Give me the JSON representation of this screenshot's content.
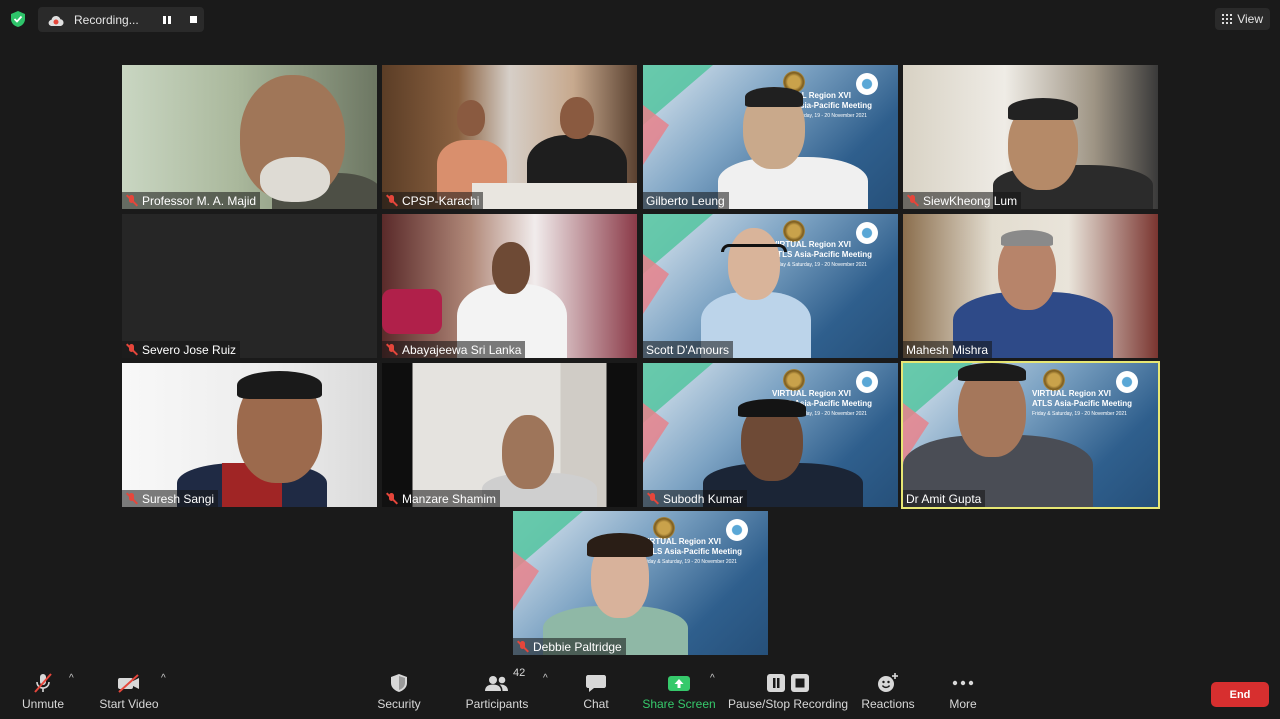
{
  "top_bar": {
    "recording_label": "Recording...",
    "view_label": "View"
  },
  "participants": [
    {
      "name": "Professor M. A. Majid",
      "muted": true
    },
    {
      "name": "CPSP-Karachi",
      "muted": true
    },
    {
      "name": "Gilberto Leung",
      "muted": false
    },
    {
      "name": "SiewKheong Lum",
      "muted": true
    },
    {
      "name": "Severo Jose Ruiz",
      "muted": true
    },
    {
      "name": "Abayajeewa Sri Lanka",
      "muted": true
    },
    {
      "name": "Scott D'Amours",
      "muted": false
    },
    {
      "name": "Mahesh Mishra",
      "muted": false
    },
    {
      "name": "Suresh Sangi",
      "muted": true
    },
    {
      "name": "Manzare Shamim",
      "muted": true
    },
    {
      "name": "Subodh Kumar",
      "muted": true
    },
    {
      "name": "Dr Amit Gupta",
      "muted": false,
      "active_speaker": true
    },
    {
      "name": "Debbie Paltridge",
      "muted": true
    }
  ],
  "atls_background": {
    "line1": "VIRTUAL Region XVI",
    "line2": "ATLS Asia-Pacific Meeting",
    "line3": "Friday & Saturday, 19 - 20 November 2021"
  },
  "toolbar": {
    "unmute_label": "Unmute",
    "start_video_label": "Start Video",
    "security_label": "Security",
    "participants_label": "Participants",
    "participants_count": "42",
    "chat_label": "Chat",
    "share_screen_label": "Share Screen",
    "pause_stop_recording_label": "Pause/Stop Recording",
    "reactions_label": "Reactions",
    "more_label": "More",
    "end_label": "End"
  },
  "colors": {
    "background": "#1a1a1a",
    "active_speaker_border": "#e7e774",
    "muted_red": "#e5463b",
    "share_green": "#36c96b",
    "end_red": "#d72f2f"
  }
}
